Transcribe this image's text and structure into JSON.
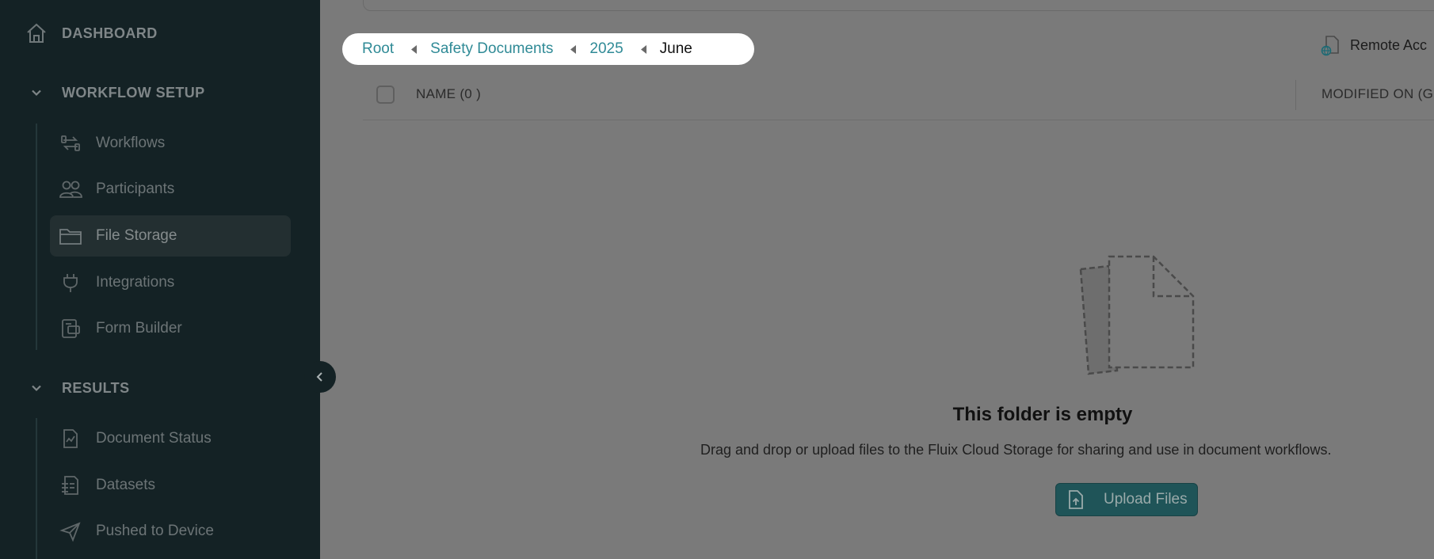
{
  "sidebar": {
    "dashboard": {
      "label": "DASHBOARD",
      "icon": "home-icon"
    },
    "sections": [
      {
        "title": "WORKFLOW SETUP",
        "items": [
          {
            "label": "Workflows",
            "icon": "workflows-icon"
          },
          {
            "label": "Participants",
            "icon": "participants-icon"
          },
          {
            "label": "File Storage",
            "icon": "folder-icon",
            "active": true
          },
          {
            "label": "Integrations",
            "icon": "plug-icon"
          },
          {
            "label": "Form Builder",
            "icon": "form-builder-icon"
          }
        ]
      },
      {
        "title": "RESULTS",
        "items": [
          {
            "label": "Document Status",
            "icon": "document-status-icon"
          },
          {
            "label": "Datasets",
            "icon": "datasets-icon"
          },
          {
            "label": "Pushed to Device",
            "icon": "send-icon"
          }
        ]
      }
    ]
  },
  "breadcrumb": {
    "items": [
      "Root",
      "Safety Documents",
      "2025",
      "June"
    ]
  },
  "header": {
    "remote_access_label": "Remote Acc"
  },
  "table": {
    "name_header": "NAME  (0 )",
    "modified_header": "MODIFIED ON (GI"
  },
  "empty_state": {
    "title": "This folder is empty",
    "description": "Drag and drop or upload files to the Fluix Cloud Storage for sharing and use in document workflows.",
    "upload_label": "Upload Files"
  },
  "colors": {
    "sidebar_bg": "#142225",
    "overlay_bg": "#7a7a7a",
    "accent": "#2f8a96",
    "button_bg": "#1f5458"
  }
}
